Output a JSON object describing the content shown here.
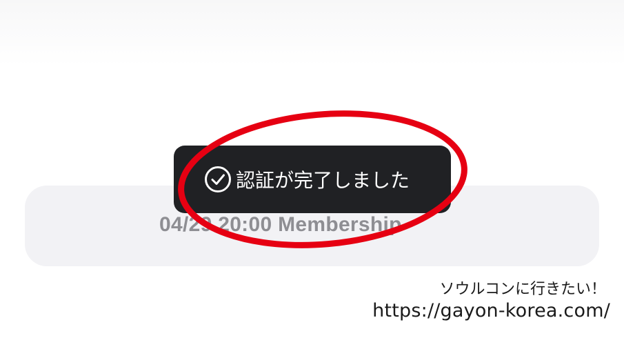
{
  "toast": {
    "icon": "check-circle-icon",
    "message": "認証が完了しました"
  },
  "membership_button": {
    "label": "04/29 20:00 Membership"
  },
  "annotation": {
    "shape": "ellipse",
    "color": "#e60012"
  },
  "watermark": {
    "line1": "ソウルコンに行きたい！",
    "line2": "https://gayon-korea.com/"
  },
  "colors": {
    "toast_background": "#202124",
    "button_background": "#f2f2f5",
    "button_text": "#8e8e93"
  }
}
